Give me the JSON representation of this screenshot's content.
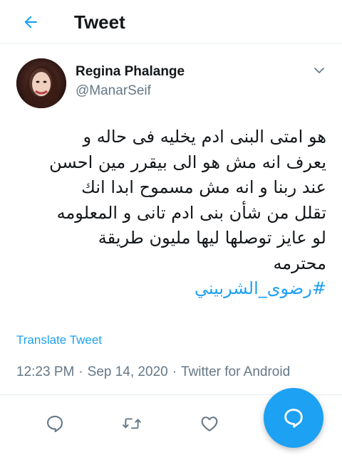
{
  "header": {
    "title": "Tweet",
    "back_icon": "arrow-left-icon"
  },
  "author": {
    "display_name": "Regina Phalange",
    "handle": "@ManarSeif"
  },
  "tweet": {
    "lines": [
      "هو امتى البنى ادم يخليه فى حاله و",
      "يعرف انه مش هو الى بيقرر مين احسن",
      "عند ربنا و انه مش مسموح ابدا انك",
      "تقلل من شأن بنى ادم تانى و المعلومه",
      "لو عايز توصلها ليها مليون طريقة",
      "محترمه"
    ],
    "hashtag": "#رضوى_الشربيني"
  },
  "translate_label": "Translate Tweet",
  "meta": {
    "time": "12:23 PM",
    "date": "Sep 14, 2020",
    "source": "Twitter for Android",
    "separator": "·"
  },
  "actions": {
    "reply_icon": "reply-icon",
    "retweet_icon": "retweet-icon",
    "like_icon": "heart-icon",
    "compose_icon": "compose-reply-icon"
  },
  "colors": {
    "accent": "#1da1f2",
    "text_primary": "#14171a",
    "text_secondary": "#657786",
    "border": "#e6ecf0"
  }
}
